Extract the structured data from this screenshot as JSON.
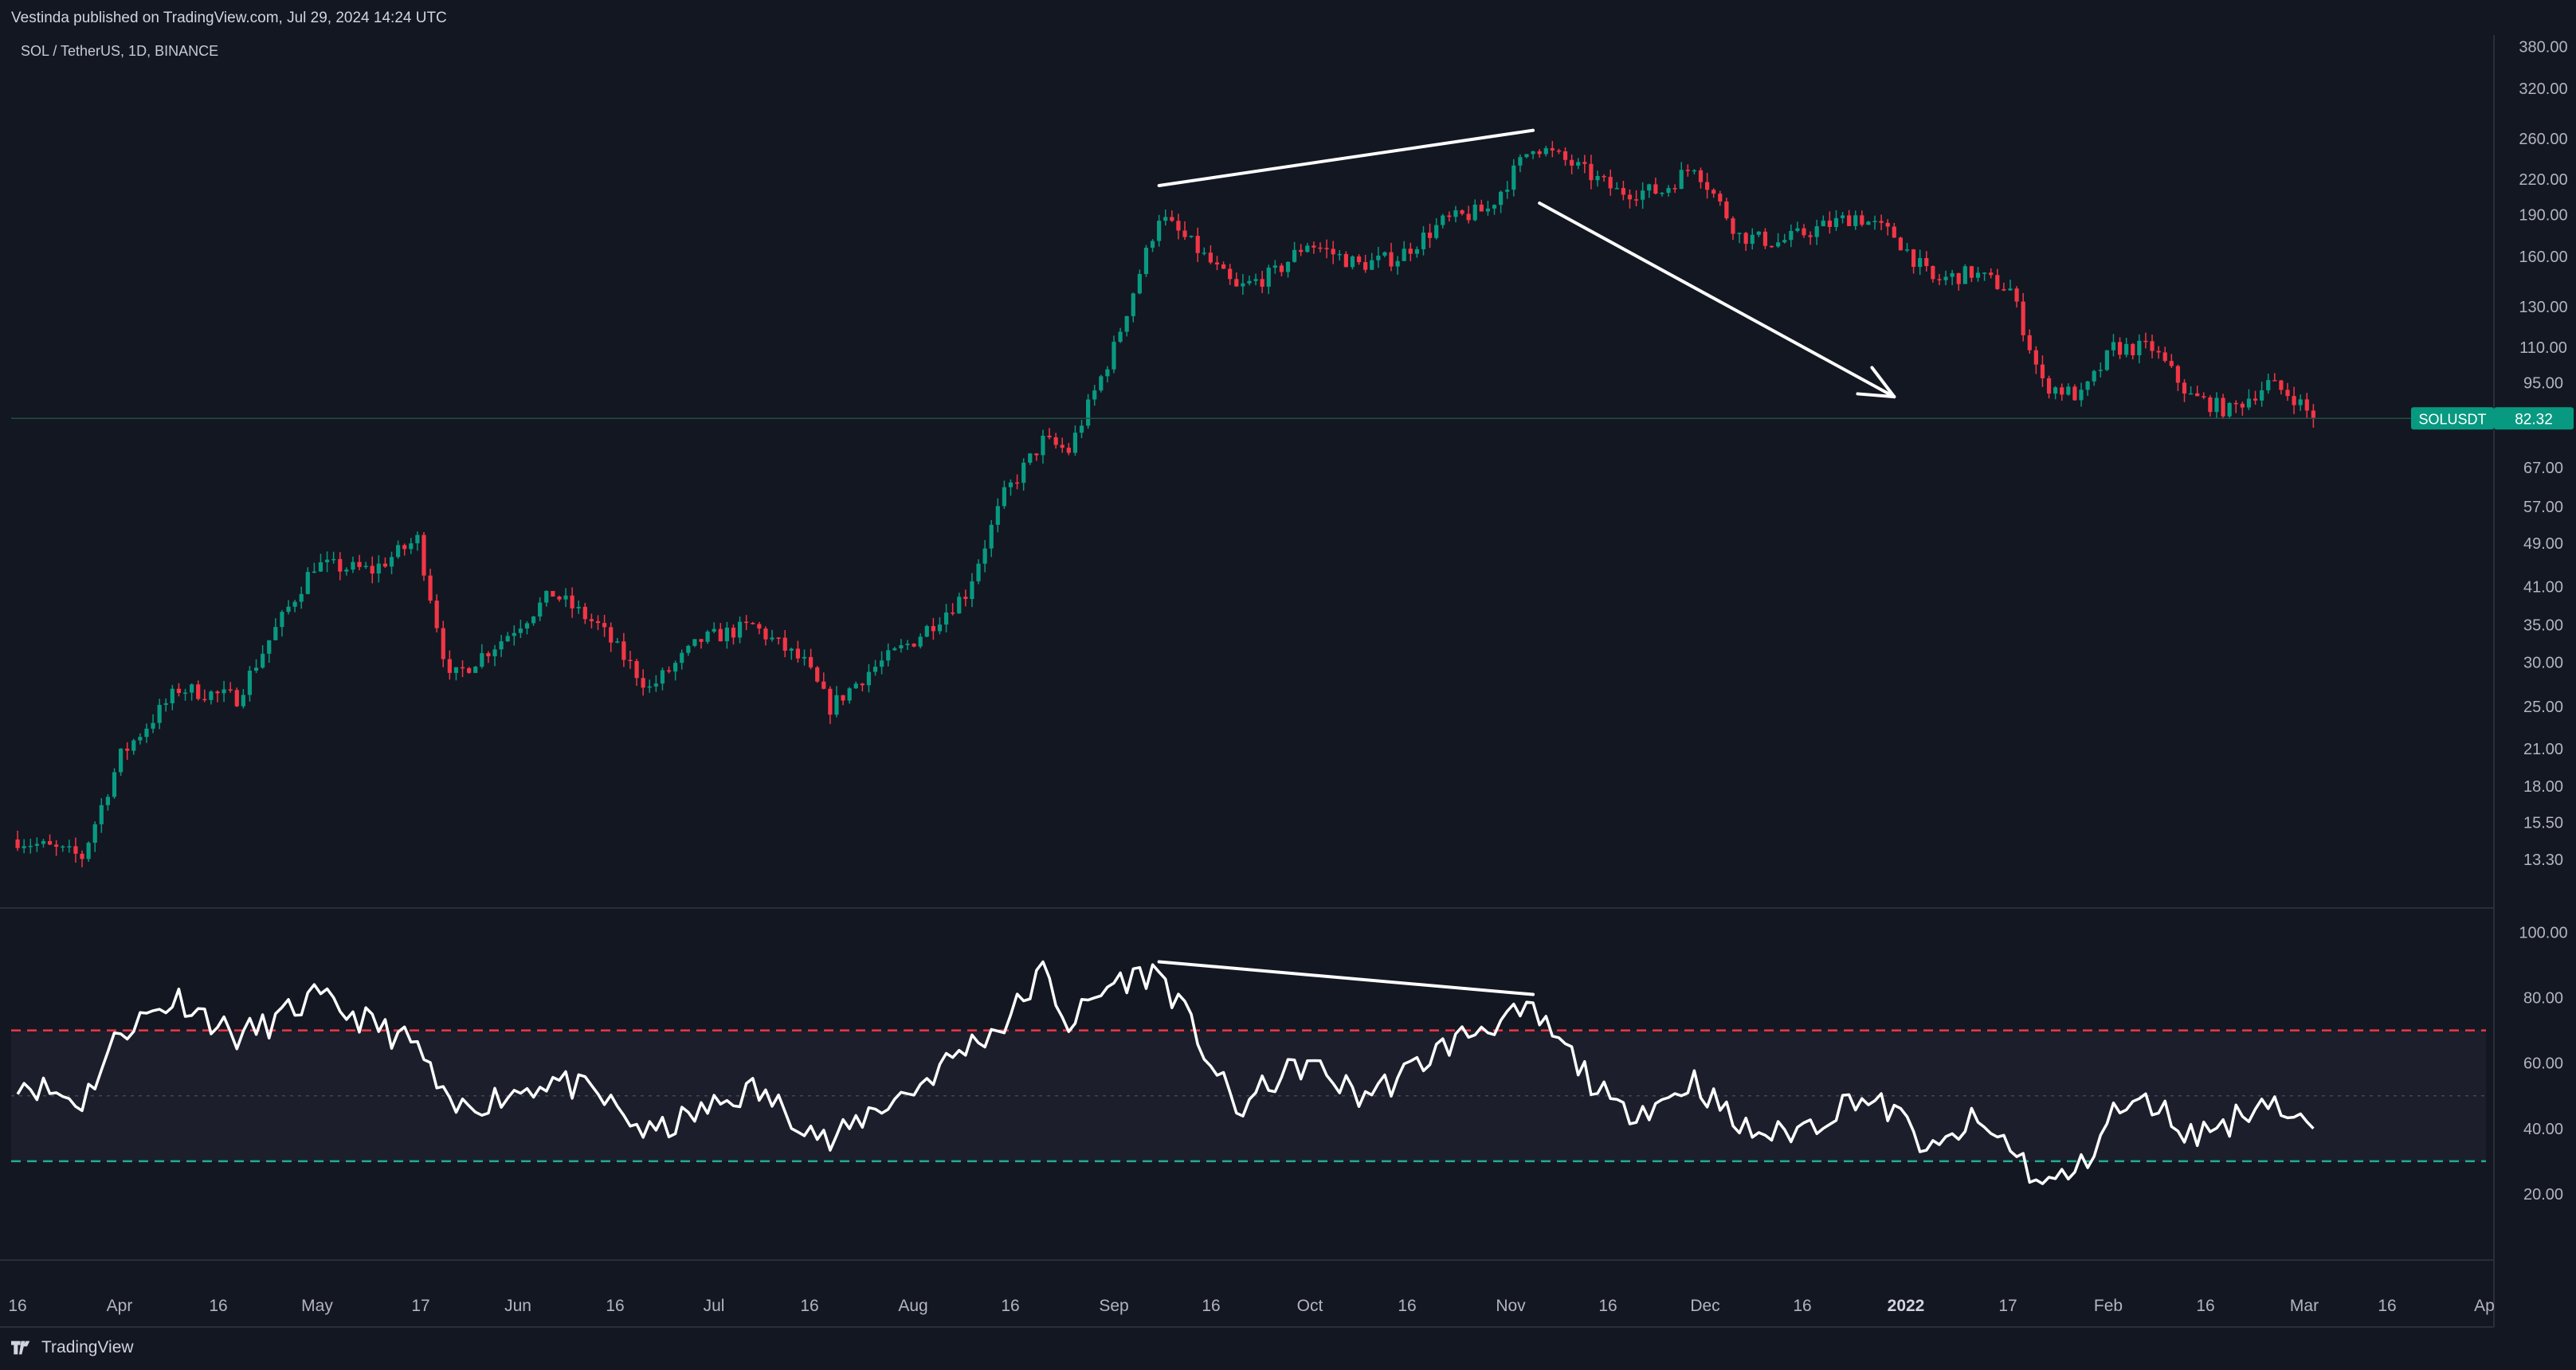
{
  "header": {
    "published": "Vestinda published on TradingView.com, Jul 29, 2024 14:24 UTC",
    "symbol": "SOL / TetherUS, 1D, BINANCE"
  },
  "footer": {
    "brand": "TradingView"
  },
  "colors": {
    "bg": "#131722",
    "up": "#26a69a",
    "down": "#ef5350",
    "up_candle": "#089981",
    "down_candle": "#f23645",
    "rsi_line": "#ffffff",
    "rsi_upper": "#f23645",
    "rsi_lower": "#22ab94",
    "price_label": "#089981"
  },
  "price_axis": {
    "ticks": [
      "380.00",
      "320.00",
      "260.00",
      "220.00",
      "190.00",
      "160.00",
      "130.00",
      "110.00",
      "95.00",
      "67.00",
      "57.00",
      "49.00",
      "41.00",
      "35.00",
      "30.00",
      "25.00",
      "21.00",
      "18.00",
      "15.50",
      "13.30"
    ],
    "scale": "log"
  },
  "last_price": {
    "symbol": "SOLUSDT",
    "value": "82.32"
  },
  "rsi_axis": {
    "ticks": [
      "100.00",
      "80.00",
      "60.00",
      "40.00",
      "20.00"
    ]
  },
  "time_axis": {
    "labels": [
      "16",
      "Apr",
      "16",
      "May",
      "17",
      "Jun",
      "16",
      "Jul",
      "16",
      "Aug",
      "16",
      "Sep",
      "16",
      "Oct",
      "16",
      "Nov",
      "16",
      "Dec",
      "16",
      "2022",
      "17",
      "Feb",
      "16",
      "Mar",
      "16",
      "Ap"
    ]
  },
  "chart_data": {
    "type": "line",
    "title": "SOL / TetherUS, 1D, BINANCE",
    "note": "Daily candlestick price (log scale) with RSI indicator pane",
    "price_series": {
      "name": "SOLUSDT",
      "points": [
        [
          "2021-03-16",
          14.5
        ],
        [
          "2021-03-26",
          13.5
        ],
        [
          "2021-04-01",
          20.5
        ],
        [
          "2021-04-10",
          27
        ],
        [
          "2021-04-19",
          26
        ],
        [
          "2021-04-24",
          33
        ],
        [
          "2021-05-01",
          45
        ],
        [
          "2021-05-10",
          44
        ],
        [
          "2021-05-17",
          50
        ],
        [
          "2021-05-22",
          28
        ],
        [
          "2021-05-30",
          33
        ],
        [
          "2021-06-07",
          40
        ],
        [
          "2021-06-14",
          35
        ],
        [
          "2021-06-22",
          27
        ],
        [
          "2021-06-30",
          33
        ],
        [
          "2021-07-08",
          35
        ],
        [
          "2021-07-16",
          30
        ],
        [
          "2021-07-20",
          25
        ],
        [
          "2021-07-26",
          29
        ],
        [
          "2021-08-02",
          33
        ],
        [
          "2021-08-10",
          40
        ],
        [
          "2021-08-16",
          60
        ],
        [
          "2021-08-22",
          75
        ],
        [
          "2021-08-26",
          72
        ],
        [
          "2021-09-02",
          110
        ],
        [
          "2021-09-09",
          190
        ],
        [
          "2021-09-15",
          165
        ],
        [
          "2021-09-21",
          140
        ],
        [
          "2021-09-27",
          150
        ],
        [
          "2021-10-02",
          170
        ],
        [
          "2021-10-10",
          155
        ],
        [
          "2021-10-16",
          160
        ],
        [
          "2021-10-23",
          185
        ],
        [
          "2021-10-30",
          195
        ],
        [
          "2021-11-06",
          255
        ],
        [
          "2021-11-12",
          235
        ],
        [
          "2021-11-19",
          210
        ],
        [
          "2021-11-26",
          210
        ],
        [
          "2021-12-01",
          235
        ],
        [
          "2021-12-08",
          175
        ],
        [
          "2021-12-14",
          170
        ],
        [
          "2021-12-20",
          180
        ],
        [
          "2021-12-26",
          190
        ],
        [
          "2022-01-01",
          175
        ],
        [
          "2022-01-07",
          145
        ],
        [
          "2022-01-13",
          150
        ],
        [
          "2022-01-19",
          140
        ],
        [
          "2022-01-24",
          95
        ],
        [
          "2022-01-30",
          90
        ],
        [
          "2022-02-04",
          110
        ],
        [
          "2022-02-10",
          110
        ],
        [
          "2022-02-16",
          90
        ],
        [
          "2022-02-22",
          85
        ],
        [
          "2022-02-28",
          95
        ],
        [
          "2022-03-04",
          90
        ],
        [
          "2022-03-07",
          82.32
        ]
      ]
    },
    "rsi_series": {
      "name": "RSI",
      "upper": 70,
      "lower": 30,
      "middle": 50,
      "points": [
        [
          "2021-03-16",
          55
        ],
        [
          "2021-03-26",
          48
        ],
        [
          "2021-04-01",
          70
        ],
        [
          "2021-04-10",
          80
        ],
        [
          "2021-04-19",
          68
        ],
        [
          "2021-04-24",
          72
        ],
        [
          "2021-05-01",
          80
        ],
        [
          "2021-05-10",
          72
        ],
        [
          "2021-05-17",
          65
        ],
        [
          "2021-05-22",
          45
        ],
        [
          "2021-05-30",
          50
        ],
        [
          "2021-06-07",
          55
        ],
        [
          "2021-06-14",
          50
        ],
        [
          "2021-06-22",
          38
        ],
        [
          "2021-06-30",
          45
        ],
        [
          "2021-07-08",
          52
        ],
        [
          "2021-07-16",
          42
        ],
        [
          "2021-07-20",
          35
        ],
        [
          "2021-07-26",
          45
        ],
        [
          "2021-08-02",
          52
        ],
        [
          "2021-08-10",
          65
        ],
        [
          "2021-08-16",
          72
        ],
        [
          "2021-08-22",
          88
        ],
        [
          "2021-08-26",
          72
        ],
        [
          "2021-09-02",
          85
        ],
        [
          "2021-09-09",
          88
        ],
        [
          "2021-09-15",
          68
        ],
        [
          "2021-09-21",
          45
        ],
        [
          "2021-09-27",
          55
        ],
        [
          "2021-10-02",
          60
        ],
        [
          "2021-10-10",
          50
        ],
        [
          "2021-10-16",
          55
        ],
        [
          "2021-10-23",
          65
        ],
        [
          "2021-10-30",
          72
        ],
        [
          "2021-11-06",
          75
        ],
        [
          "2021-11-12",
          62
        ],
        [
          "2021-11-19",
          45
        ],
        [
          "2021-11-26",
          48
        ],
        [
          "2021-12-01",
          55
        ],
        [
          "2021-12-08",
          40
        ],
        [
          "2021-12-14",
          38
        ],
        [
          "2021-12-20",
          42
        ],
        [
          "2021-12-26",
          50
        ],
        [
          "2022-01-01",
          45
        ],
        [
          "2022-01-07",
          32
        ],
        [
          "2022-01-13",
          42
        ],
        [
          "2022-01-19",
          35
        ],
        [
          "2022-01-24",
          22
        ],
        [
          "2022-01-30",
          28
        ],
        [
          "2022-02-04",
          45
        ],
        [
          "2022-02-10",
          48
        ],
        [
          "2022-02-16",
          38
        ],
        [
          "2022-02-22",
          42
        ],
        [
          "2022-02-28",
          50
        ],
        [
          "2022-03-04",
          42
        ],
        [
          "2022-03-07",
          40
        ]
      ]
    },
    "annotations": [
      {
        "type": "trendline",
        "pane": "price",
        "from": [
          "2021-09-09",
          215
        ],
        "to": [
          "2021-11-06",
          270
        ]
      },
      {
        "type": "arrow",
        "pane": "price",
        "from": [
          "2021-11-07",
          200
        ],
        "to": [
          "2022-01-01",
          90
        ]
      },
      {
        "type": "trendline",
        "pane": "rsi",
        "from": [
          "2021-09-09",
          91
        ],
        "to": [
          "2021-11-06",
          81
        ]
      }
    ]
  }
}
